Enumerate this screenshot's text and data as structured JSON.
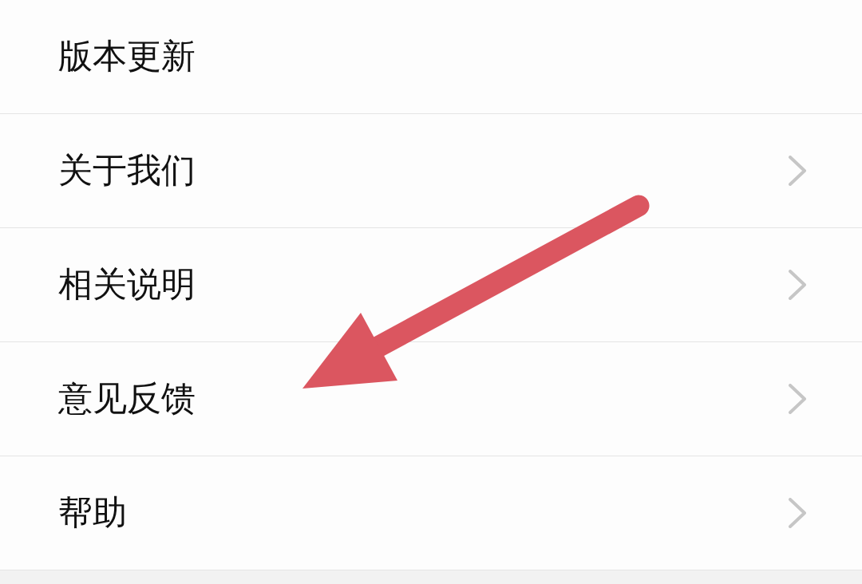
{
  "settings_list": {
    "items": [
      {
        "label": "版本更新",
        "chevron": false
      },
      {
        "label": "关于我们",
        "chevron": true
      },
      {
        "label": "相关说明",
        "chevron": true
      },
      {
        "label": "意见反馈",
        "chevron": true
      },
      {
        "label": "帮助",
        "chevron": true
      }
    ]
  }
}
